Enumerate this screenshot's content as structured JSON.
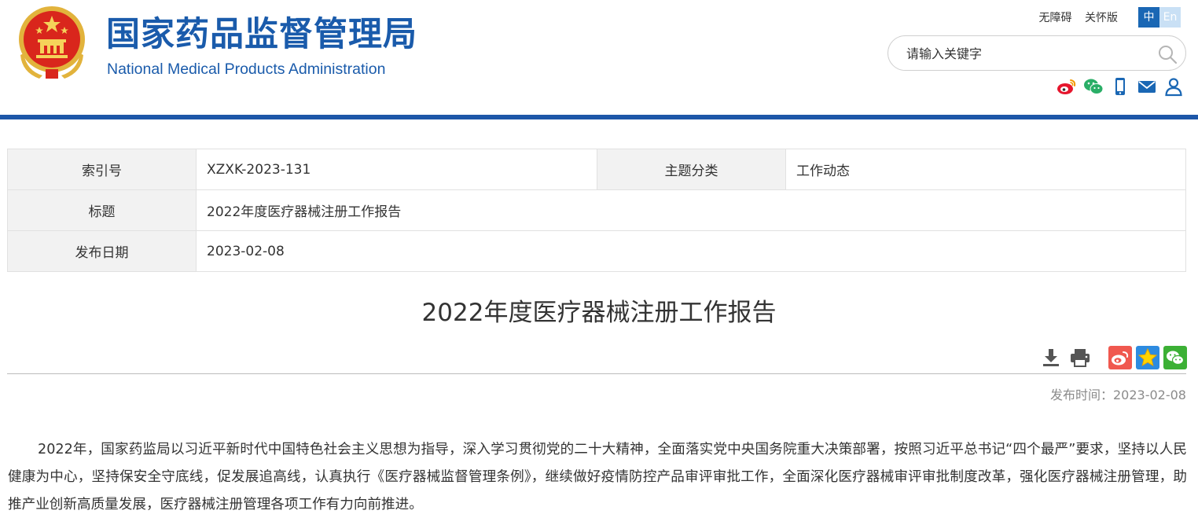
{
  "header": {
    "title_cn": "国家药品监督管理局",
    "title_en": "National Medical Products Administration",
    "links": [
      "无障碍",
      "关怀版"
    ],
    "lang": {
      "zh": "中",
      "en": "En"
    },
    "search": {
      "placeholder": "请输入关键字"
    },
    "social_icons": [
      "weibo-icon",
      "wechat-icon",
      "mobile-icon",
      "mail-icon",
      "user-icon"
    ]
  },
  "info_table": {
    "index_label": "索引号",
    "index_value": "XZXK-2023-131",
    "category_label": "主题分类",
    "category_value": "工作动态",
    "title_label": "标题",
    "title_value": "2022年度医疗器械注册工作报告",
    "date_label": "发布日期",
    "date_value": "2023-02-08"
  },
  "article": {
    "title": "2022年度医疗器械注册工作报告",
    "publish_time": "发布时间：2023-02-08",
    "paragraph_1": "2022年，国家药监局以习近平新时代中国特色社会主义思想为指导，深入学习贯彻党的二十大精神，全面落实党中央国务院重大决策部署，按照习近平总书记“四个最严”要求，坚持以人民健康为中心，坚持保安全守底线，促发展追高线，认真执行《医疗器械监督管理条例》，继续做好疫情防控产品审评审批工作，全面深化医疗器械审评审批制度改革，强化医疗器械注册管理，助推产业创新高质量发展，医疗器械注册管理各项工作有力向前推进。",
    "tool_icons": [
      "download-icon",
      "print-icon",
      "weibo-share-icon",
      "favorite-icon",
      "wechat-share-icon"
    ]
  },
  "colors": {
    "brand_blue": "#1a5bab",
    "header_bar": "#1d57a8",
    "emblem_red": "#d9261c",
    "emblem_gold": "#f2c14e"
  }
}
